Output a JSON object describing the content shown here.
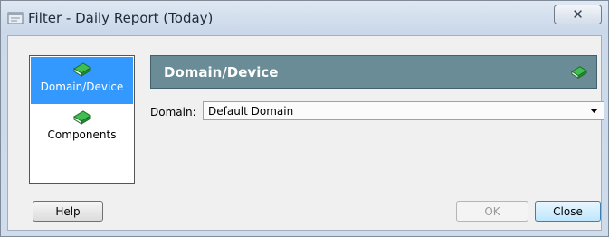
{
  "window": {
    "title": "Filter - Daily Report (Today)",
    "close_glyph": "✕"
  },
  "nav": {
    "items": [
      {
        "label": "Domain/Device",
        "icon": "book-icon",
        "selected": true
      },
      {
        "label": "Components",
        "icon": "book-icon",
        "selected": false
      }
    ]
  },
  "panel": {
    "title": "Domain/Device",
    "domain_label": "Domain:",
    "domain_value": "Default Domain"
  },
  "buttons": {
    "help": "Help",
    "ok": "OK",
    "close": "Close"
  },
  "colors": {
    "header_bar": "#6a8c97",
    "selection": "#3399ff",
    "book_green": "#2e9a3c"
  }
}
